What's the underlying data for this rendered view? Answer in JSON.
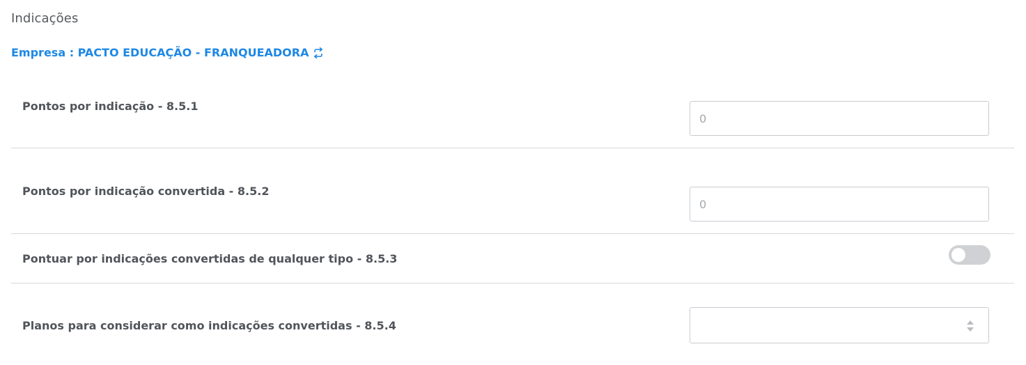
{
  "page": {
    "title": "Indicações"
  },
  "company": {
    "label": "Empresa : PACTO EDUCAÇÃO - FRANQUEADORA",
    "icon": "swap-arrows-icon",
    "color": "#1e88e5"
  },
  "settings": [
    {
      "label": "Pontos por indicação - 8.5.1",
      "type": "number-input",
      "value": "",
      "placeholder": "0"
    },
    {
      "label": "Pontos por indicação convertida - 8.5.2",
      "type": "number-input",
      "value": "",
      "placeholder": "0"
    },
    {
      "label": "Pontuar por indicações convertidas de qualquer tipo - 8.5.3",
      "type": "toggle",
      "checked": false
    },
    {
      "label": "Planos para considerar como indicações convertidas - 8.5.4",
      "type": "select",
      "selected": "",
      "icon": "sort-updown-icon"
    }
  ]
}
